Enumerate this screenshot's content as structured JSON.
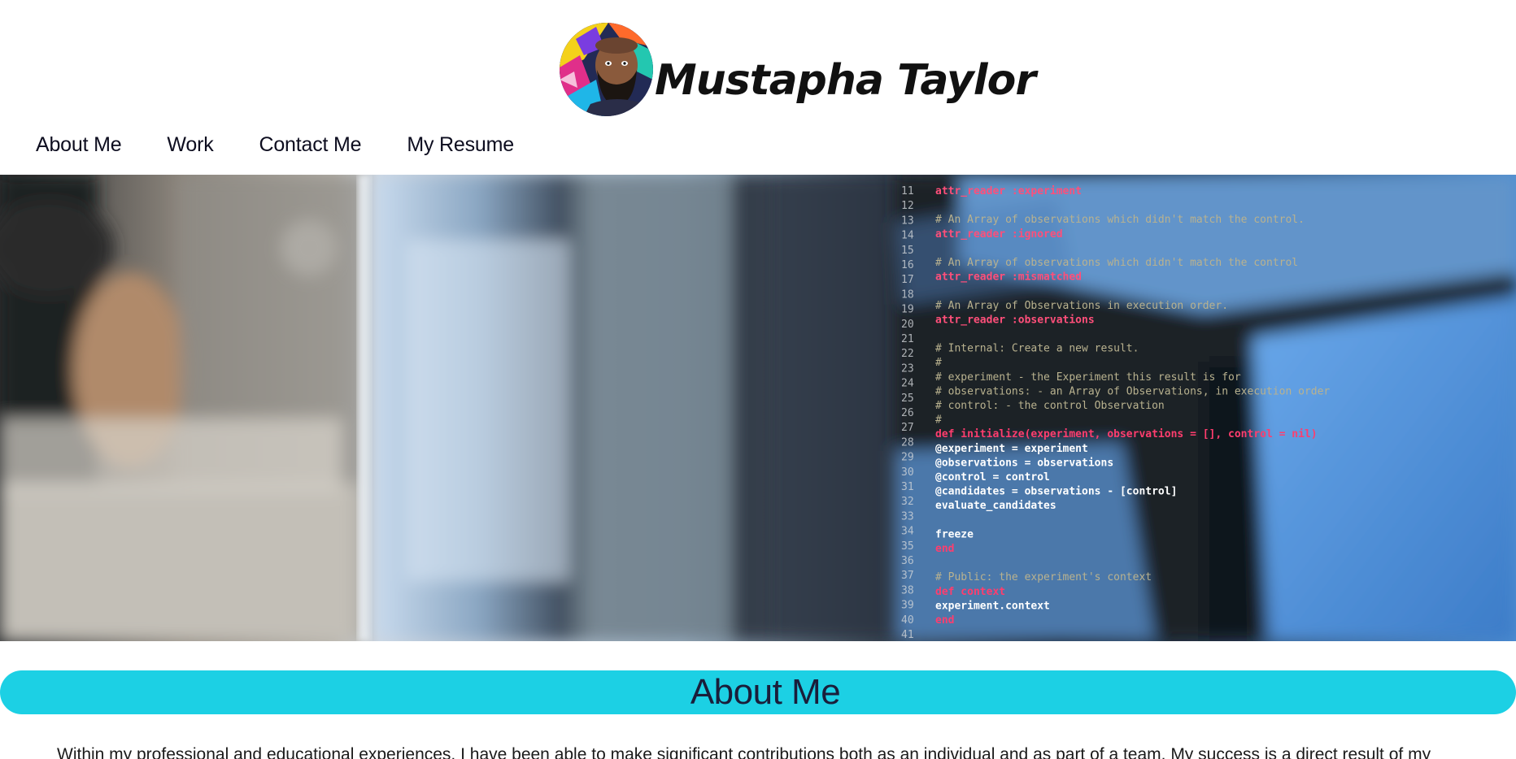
{
  "site": {
    "name": "Mustapha Taylor",
    "avatar_icon": "avatar-illustration"
  },
  "nav": {
    "items": [
      {
        "label": "About Me"
      },
      {
        "label": "Work"
      },
      {
        "label": "Contact Me"
      },
      {
        "label": "My Resume"
      }
    ]
  },
  "hero": {
    "code_lines": [
      {
        "num": "11",
        "text": "attr_reader :experiment"
      },
      {
        "num": "12",
        "text": ""
      },
      {
        "num": "13",
        "text": "# An Array of observations which didn't match the control."
      },
      {
        "num": "14",
        "text": "attr_reader :ignored"
      },
      {
        "num": "15",
        "text": ""
      },
      {
        "num": "16",
        "text": "# An Array of observations which didn't match the control"
      },
      {
        "num": "17",
        "text": "attr_reader :mismatched"
      },
      {
        "num": "18",
        "text": ""
      },
      {
        "num": "19",
        "text": "# An Array of Observations in execution order."
      },
      {
        "num": "20",
        "text": "attr_reader :observations"
      },
      {
        "num": "21",
        "text": ""
      },
      {
        "num": "22",
        "text": "# Internal: Create a new result."
      },
      {
        "num": "23",
        "text": "#"
      },
      {
        "num": "24",
        "text": "# experiment    - the Experiment this result is for"
      },
      {
        "num": "25",
        "text": "# observations: - an Array of Observations, in execution order"
      },
      {
        "num": "26",
        "text": "# control:      - the control Observation"
      },
      {
        "num": "27",
        "text": "#"
      },
      {
        "num": "28",
        "text": "def initialize(experiment, observations = [], control = nil)"
      },
      {
        "num": "29",
        "text": "  @experiment   = experiment"
      },
      {
        "num": "30",
        "text": "  @observations = observations"
      },
      {
        "num": "31",
        "text": "  @control      = control"
      },
      {
        "num": "32",
        "text": "  @candidates   = observations - [control]"
      },
      {
        "num": "33",
        "text": "  evaluate_candidates"
      },
      {
        "num": "34",
        "text": ""
      },
      {
        "num": "35",
        "text": "  freeze"
      },
      {
        "num": "36",
        "text": "end"
      },
      {
        "num": "37",
        "text": ""
      },
      {
        "num": "38",
        "text": "# Public: the experiment's context"
      },
      {
        "num": "39",
        "text": "def context"
      },
      {
        "num": "40",
        "text": "  experiment.context"
      },
      {
        "num": "41",
        "text": "end"
      },
      {
        "num": "42",
        "text": ""
      }
    ]
  },
  "about": {
    "heading": "About Me",
    "text": "Within my professional and educational experiences, I have been able to make significant contributions both as an individual and as part of a team. My success is a direct result of my"
  },
  "colors": {
    "accent": "#1cd0e4",
    "heading_text": "#1a1e3a",
    "nav_text": "#0d0d1f"
  }
}
